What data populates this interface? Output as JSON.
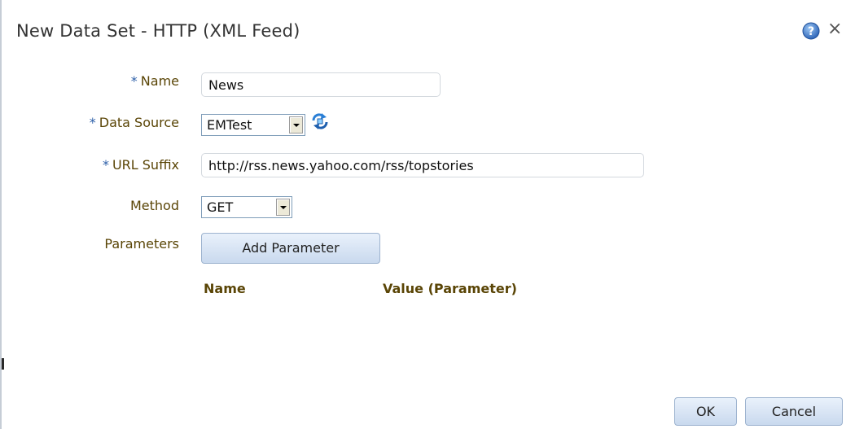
{
  "dialog": {
    "title": "New Data Set - HTTP (XML Feed)",
    "help_icon": "help-icon",
    "close_icon": "close-icon",
    "close_glyph": "×"
  },
  "form": {
    "name": {
      "required_mark": "*",
      "label": "Name",
      "value": "News"
    },
    "data_source": {
      "required_mark": "*",
      "label": "Data Source",
      "value": "EMTest",
      "refresh_icon": "refresh-icon"
    },
    "url_suffix": {
      "required_mark": "*",
      "label": "URL Suffix",
      "value": "http://rss.news.yahoo.com/rss/topstories"
    },
    "method": {
      "label": "Method",
      "value": "GET"
    },
    "parameters": {
      "label": "Parameters",
      "add_button_label": "Add Parameter"
    }
  },
  "parameters_table": {
    "columns": [
      "Name",
      "Value (Parameter)"
    ]
  },
  "footer": {
    "ok_label": "OK",
    "cancel_label": "Cancel"
  },
  "colors": {
    "label_text": "#5a4506",
    "required_mark": "#2c5fa8",
    "button_gradient_top": "#e9f1fb",
    "button_gradient_bottom": "#c9d9ee",
    "help_icon": "#3a76c9"
  }
}
